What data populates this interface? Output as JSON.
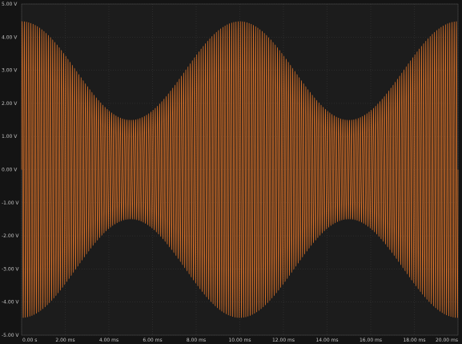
{
  "chart_data": {
    "type": "line",
    "title": "",
    "xlabel": "",
    "ylabel": "",
    "x_unit": "ms",
    "y_unit": "V",
    "xlim": [
      0,
      20
    ],
    "ylim": [
      -5,
      5
    ],
    "x_ticks": [
      {
        "value": 0,
        "label": "0.00 s"
      },
      {
        "value": 2,
        "label": "2.00 ms"
      },
      {
        "value": 4,
        "label": "4.00 ms"
      },
      {
        "value": 6,
        "label": "6.00 ms"
      },
      {
        "value": 8,
        "label": "8.00 ms"
      },
      {
        "value": 10,
        "label": "10.00 ms"
      },
      {
        "value": 12,
        "label": "12.00 ms"
      },
      {
        "value": 14,
        "label": "14.00 ms"
      },
      {
        "value": 16,
        "label": "16.00 ms"
      },
      {
        "value": 18,
        "label": "18.00 ms"
      },
      {
        "value": 20,
        "label": "20.00 ms"
      }
    ],
    "y_ticks": [
      {
        "value": 5,
        "label": "5.00 V"
      },
      {
        "value": 4,
        "label": "4.00 V"
      },
      {
        "value": 3,
        "label": "3.00 V"
      },
      {
        "value": 2,
        "label": "2.00 V"
      },
      {
        "value": 1,
        "label": "1.00 V"
      },
      {
        "value": 0,
        "label": "0.00 V"
      },
      {
        "value": -1,
        "label": "-1.00 V"
      },
      {
        "value": -2,
        "label": "-2.00 V"
      },
      {
        "value": -3,
        "label": "-3.00 V"
      },
      {
        "value": -4,
        "label": "-4.00 V"
      },
      {
        "value": -5,
        "label": "-5.00 V"
      }
    ],
    "grid": true,
    "series": [
      {
        "color": "#e8782a",
        "signal": "amplitude-modulated sine",
        "amplitude_envelope": {
          "peak_amplitude": 4.5,
          "trough_amplitude": 1.5,
          "peaks_at": [
            0,
            10,
            20
          ],
          "troughs_at": [
            5,
            15
          ]
        },
        "carrier_frequency_khz": 10,
        "envelope_period_ms": 10
      }
    ]
  },
  "colors": {
    "background": "#141414",
    "plot_background": "#1c1c1c",
    "grid": "#3a3a3a",
    "tick_text": "#c4c4c4",
    "trace": "#e8782a"
  }
}
